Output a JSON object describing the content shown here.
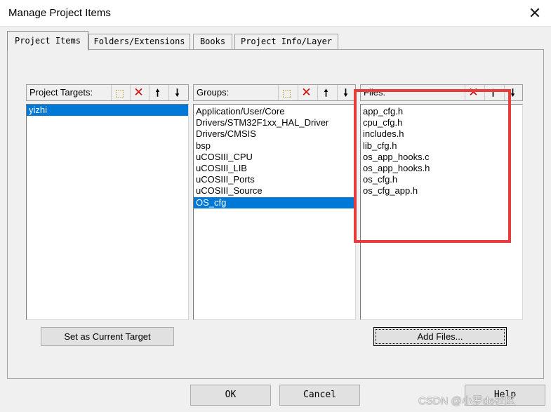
{
  "window": {
    "title": "Manage Project Items",
    "close_glyph": "✕"
  },
  "tabs": [
    {
      "label": "Project Items"
    },
    {
      "label": "Folders/Extensions"
    },
    {
      "label": "Books"
    },
    {
      "label": "Project Info/Layer"
    }
  ],
  "targets": {
    "header": "Project Targets:",
    "items": [
      "yizhi"
    ],
    "selected_index": 0,
    "set_current_label": "Set as Current Target"
  },
  "groups": {
    "header": "Groups:",
    "items": [
      "Application/User/Core",
      "Drivers/STM32F1xx_HAL_Driver",
      "Drivers/CMSIS",
      "bsp",
      "uCOSIII_CPU",
      "uCOSIII_LIB",
      "uCOSIII_Ports",
      "uCOSIII_Source",
      "OS_cfg"
    ],
    "selected_index": 8
  },
  "files": {
    "header": "Files:",
    "items": [
      "app_cfg.h",
      "cpu_cfg.h",
      "includes.h",
      "lib_cfg.h",
      "os_app_hooks.c",
      "os_app_hooks.h",
      "os_cfg.h",
      "os_cfg_app.h"
    ],
    "add_files_label": "Add Files..."
  },
  "toolbar": {
    "new_glyph": "⬚",
    "delete_glyph": "✕",
    "up_glyph": "🠕",
    "down_glyph": "🠗"
  },
  "footer": {
    "ok_label": "OK",
    "cancel_label": "Cancel",
    "help_label": "Help"
  },
  "watermark": "CSDN @小罗de社区",
  "colors": {
    "selection": "#0078d7",
    "highlight_box": "#e83c3c"
  }
}
